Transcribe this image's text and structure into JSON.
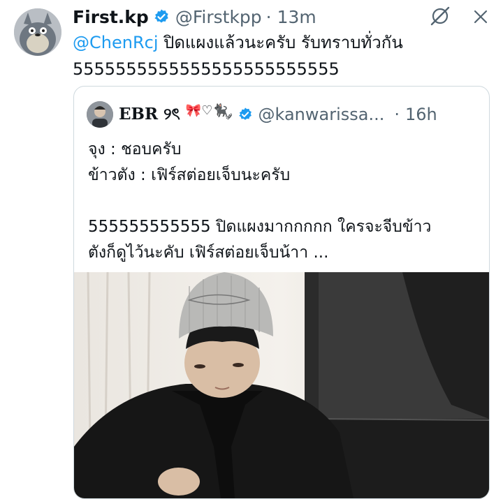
{
  "tweet": {
    "author_name": "First.kp",
    "handle": "@Firstkpp",
    "dot": "·",
    "time": "13m",
    "mention": "@ChenRcj",
    "text_after_mention": " ปิดแผงแล้วนะครับ รับทราบทั่วกัน",
    "text_line2": "5555555555555555555555555"
  },
  "quote": {
    "author_name": "EBR ୨ৎ",
    "emoji": "🎀♡🐈‍⬛ ༘",
    "handle": "@kanwarissa...",
    "dot": "·",
    "time": "16h",
    "lines": [
      "จุง : ชอบครับ",
      "ข้าวตัง : เฟิร์สต่อยเจ็บนะครับ",
      "555555555555 ปิดแผงมากกกกก ใครจะจีบข้าว",
      "ตังก็ดูไว้นะคับ เฟิร์สต่อยเจ็บน้าา ..."
    ]
  },
  "colors": {
    "accent": "#1d9bf0",
    "secondary_text": "#536471",
    "border": "#cfd9de"
  },
  "icons": [
    "verified-badge-icon",
    "grok-icon",
    "more-options-icon"
  ]
}
